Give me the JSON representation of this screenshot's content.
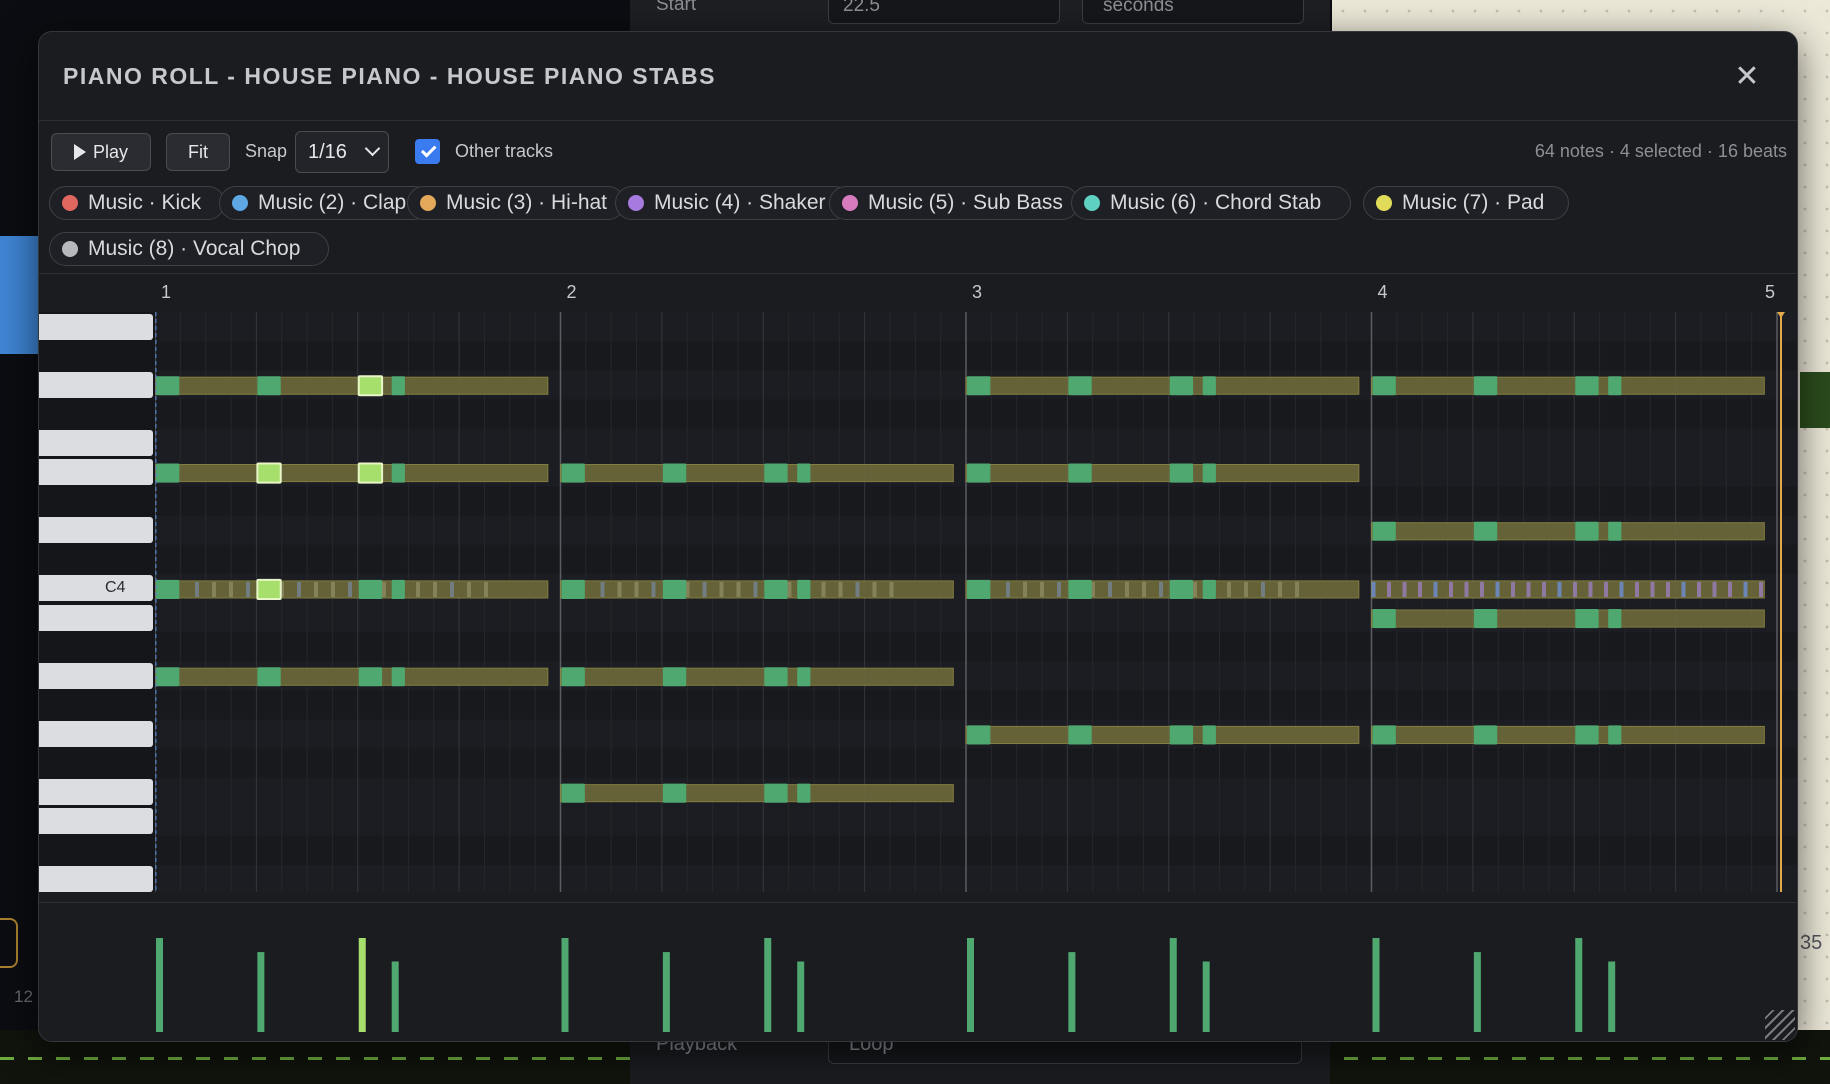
{
  "background": {
    "start_label": "Start",
    "start_value": "22.5",
    "unit_value": "seconds",
    "playback_label": "Playback",
    "playback_value": "Loop",
    "left_number": "12",
    "right_number": "35"
  },
  "modal": {
    "title": "PIANO ROLL - HOUSE PIANO - HOUSE PIANO STABS",
    "close_icon": "close-icon"
  },
  "toolbar": {
    "play_label": "Play",
    "fit_label": "Fit",
    "snap_label": "Snap",
    "snap_value": "1/16",
    "other_tracks_label": "Other tracks",
    "other_tracks_checked": true,
    "stats": "64 notes · 4 selected · 16 beats"
  },
  "tracks": [
    {
      "label": "Music · Kick",
      "color": "#e0675f"
    },
    {
      "label": "Music (2) · Clap",
      "color": "#5fa8e6"
    },
    {
      "label": "Music (3) · Hi-hat",
      "color": "#e4a85a"
    },
    {
      "label": "Music (4) · Shaker",
      "color": "#a67be0"
    },
    {
      "label": "Music (5) · Sub Bass",
      "color": "#d77bbf"
    },
    {
      "label": "Music (6) · Chord Stab",
      "color": "#5fd1c2"
    },
    {
      "label": "Music (7) · Pad",
      "color": "#e0dc5a"
    },
    {
      "label": "Music (8) · Vocal Chop",
      "color": "#b7b8bc"
    }
  ],
  "ruler": {
    "bars": [
      "1",
      "2",
      "3",
      "4",
      "5"
    ]
  },
  "keyboard": {
    "c4_label": "C4"
  },
  "colors": {
    "note": "#4fa870",
    "note_selected": "#a6df6b",
    "ghost": "#6d6a3a",
    "playhead": "#e3a94a",
    "grid_bg": "#1c1d22"
  }
}
